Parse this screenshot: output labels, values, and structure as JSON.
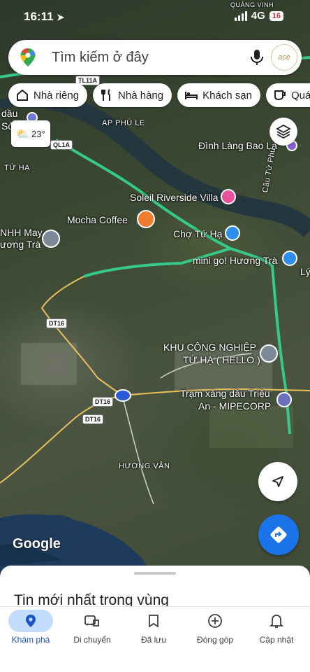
{
  "status": {
    "time": "16:11",
    "network": "4G",
    "battery": "16"
  },
  "search": {
    "placeholder": "Tìm kiếm ở đây",
    "avatar_text": "ace"
  },
  "chips": [
    {
      "label": "Nhà riêng",
      "icon": "home-icon"
    },
    {
      "label": "Nhà hàng",
      "icon": "restaurant-icon"
    },
    {
      "label": "Khách sạn",
      "icon": "hotel-icon"
    },
    {
      "label": "Quán",
      "icon": "cafe-icon"
    }
  ],
  "weather": {
    "temp": "23°"
  },
  "map": {
    "labels": {
      "ap_phu_le": "AP PHÚ LE",
      "tu_ha_left": "TỨ HẠ",
      "dinh_lang": "Đình Làng Bao La",
      "soleil": "Soleil Riverside Villa",
      "mocha": "Mocha Coffee",
      "cho_tu_ha": "Chợ Tứ Hạ",
      "mini_go": "mini go! Hương Trà",
      "tnhh_may_1": "NHH May",
      "tnhh_may_2": "ương Trà",
      "kcn_1": "KHU CÔNG NGHIỆP",
      "kcn_2": "TỨ HẠ ( HELLO )",
      "tram_xang_1": "Trạm xăng dầu Triệu",
      "tram_xang_2": "An - MIPECORP",
      "huong_van": "HƯƠNG VÂN",
      "dau": "dầu",
      "so": "Sở",
      "cau_tu_phu": "Cầu Tứ Phú",
      "ly": "Lý",
      "quang_vinh": "QUẢNG VINH"
    },
    "roads": {
      "ql1a": "QL1A",
      "tl11a": "TL11A",
      "dt16_a": "DT16",
      "dt16_b": "DT16",
      "dt16_c": "DT16"
    },
    "logo": "Google"
  },
  "sheet": {
    "title": "Tin mới nhất trong vùng"
  },
  "nav": [
    {
      "label": "Khám phá",
      "icon": "explore-pin-icon",
      "active": true
    },
    {
      "label": "Di chuyển",
      "icon": "commute-icon",
      "active": false
    },
    {
      "label": "Đã lưu",
      "icon": "bookmark-icon",
      "active": false
    },
    {
      "label": "Đóng góp",
      "icon": "add-circle-icon",
      "active": false
    },
    {
      "label": "Cập nhật",
      "icon": "bell-icon",
      "active": false
    }
  ],
  "colors": {
    "accent": "#1a73e8",
    "highway": "#36c98a",
    "active_tab_bg": "#c2dcff"
  }
}
